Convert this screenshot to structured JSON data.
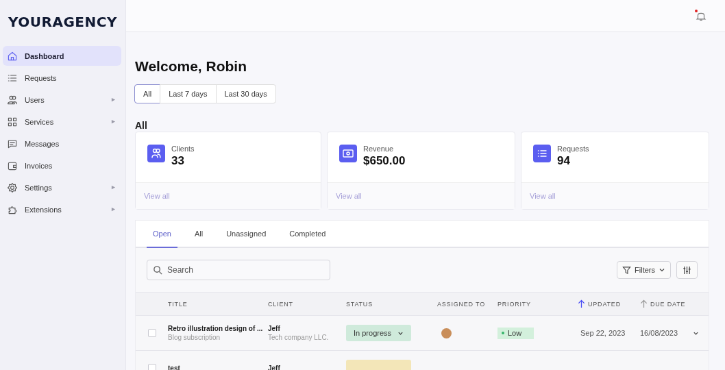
{
  "brand": "YOURAGENCY",
  "sidebar": {
    "items": [
      {
        "label": "Dashboard",
        "selected": true,
        "submenu": false
      },
      {
        "label": "Requests",
        "selected": false,
        "submenu": false
      },
      {
        "label": "Users",
        "selected": false,
        "submenu": true
      },
      {
        "label": "Services",
        "selected": false,
        "submenu": true
      },
      {
        "label": "Messages",
        "selected": false,
        "submenu": false
      },
      {
        "label": "Invoices",
        "selected": false,
        "submenu": false
      },
      {
        "label": "Settings",
        "selected": false,
        "submenu": true
      },
      {
        "label": "Extensions",
        "selected": false,
        "submenu": true
      }
    ]
  },
  "topbar": {
    "notification_unread": true
  },
  "heading": "Welcome, Robin",
  "range_filters": [
    {
      "label": "All",
      "selected": true
    },
    {
      "label": "Last 7 days",
      "selected": false
    },
    {
      "label": "Last 30 days",
      "selected": false
    }
  ],
  "section_title": "All",
  "stats": [
    {
      "label": "Clients",
      "value": "33",
      "link": "View all"
    },
    {
      "label": "Revenue",
      "value": "$650.00",
      "link": "View all"
    },
    {
      "label": "Requests",
      "value": "94",
      "link": "View all"
    }
  ],
  "tabs": [
    {
      "label": "Open",
      "selected": true
    },
    {
      "label": "All",
      "selected": false
    },
    {
      "label": "Unassigned",
      "selected": false
    },
    {
      "label": "Completed",
      "selected": false
    }
  ],
  "search": {
    "placeholder": "Search"
  },
  "filters_button": "Filters",
  "table": {
    "columns": [
      {
        "label": "TITLE"
      },
      {
        "label": "CLIENT"
      },
      {
        "label": "STATUS"
      },
      {
        "label": "ASSIGNED TO"
      },
      {
        "label": "PRIORITY"
      },
      {
        "label": "UPDATED",
        "sorted": true
      },
      {
        "label": "DUE DATE",
        "sorted": false
      }
    ],
    "rows": [
      {
        "checked": false,
        "title": "Retro illustration design of ...",
        "subtitle": "Blog subscription",
        "client": "Jeff",
        "client_detail": "Tech company LLC.",
        "status": {
          "label": "In progress",
          "color": "#cfeadb"
        },
        "assignee": true,
        "priority": {
          "label": "Low",
          "color": "#d3f0dc"
        },
        "updated": "Sep 22, 2023",
        "due": "16/08/2023"
      },
      {
        "checked": false,
        "title": "test",
        "client": "Jeff",
        "status": {
          "color": "#f3e6b8"
        }
      }
    ]
  }
}
